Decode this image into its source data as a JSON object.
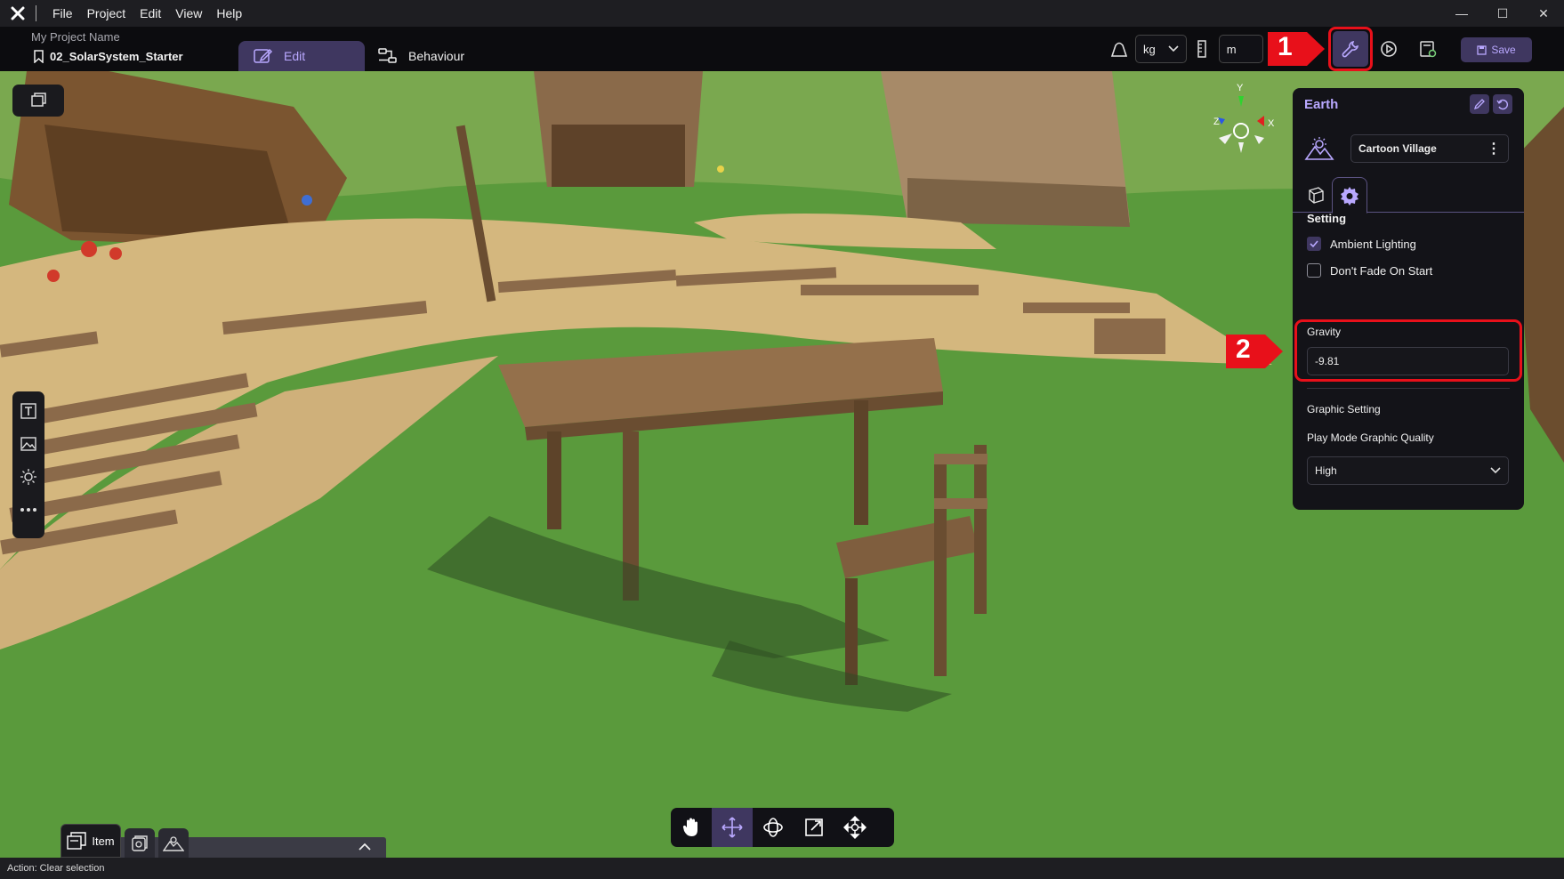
{
  "menubar": {
    "items": [
      "File",
      "Project",
      "Edit",
      "View",
      "Help"
    ]
  },
  "project": {
    "name": "My Project Name",
    "scene": "02_SolarSystem_Starter"
  },
  "tabs": {
    "edit": "Edit",
    "behaviour": "Behaviour"
  },
  "units": {
    "mass": "kg",
    "length": "m"
  },
  "toolbar": {
    "save_label": "Save"
  },
  "callouts": [
    "1",
    "2"
  ],
  "gizmo": {
    "y": "Y",
    "x": "X",
    "z": "Z"
  },
  "panel": {
    "title": "Earth",
    "environment": "Cartoon Village",
    "setting_label": "Setting",
    "ambient_lighting": {
      "label": "Ambient Lighting",
      "checked": true
    },
    "dont_fade": {
      "label": "Don't Fade On Start",
      "checked": false
    },
    "gravity_label": "Gravity",
    "gravity_value": "-9.81",
    "graphic_setting_label": "Graphic Setting",
    "play_mode_quality_label": "Play Mode Graphic Quality",
    "play_mode_quality_value": "High"
  },
  "bottom_tray": {
    "item_label": "Item"
  },
  "status": {
    "action": "Action: Clear selection"
  },
  "colors": {
    "accent": "#b9a8ff",
    "accent_bg": "#3f3760",
    "highlight_red": "#e8101a",
    "panel_bg": "#131318"
  },
  "icons": [
    "app-logo-icon",
    "bookmark-icon",
    "edit-icon",
    "behaviour-icon",
    "weight-icon",
    "ruler-icon",
    "wrench-icon",
    "play-icon",
    "publish-icon",
    "save-icon",
    "layers-icon",
    "text-icon",
    "image-icon",
    "light-icon",
    "more-icon",
    "pencil-icon",
    "reset-icon",
    "environment-icon",
    "cube-icon",
    "gear-icon",
    "hand-icon",
    "move-icon",
    "rotate-icon",
    "scale-icon",
    "transform-icon",
    "item-icon",
    "object-icon",
    "chevron-up-icon"
  ]
}
